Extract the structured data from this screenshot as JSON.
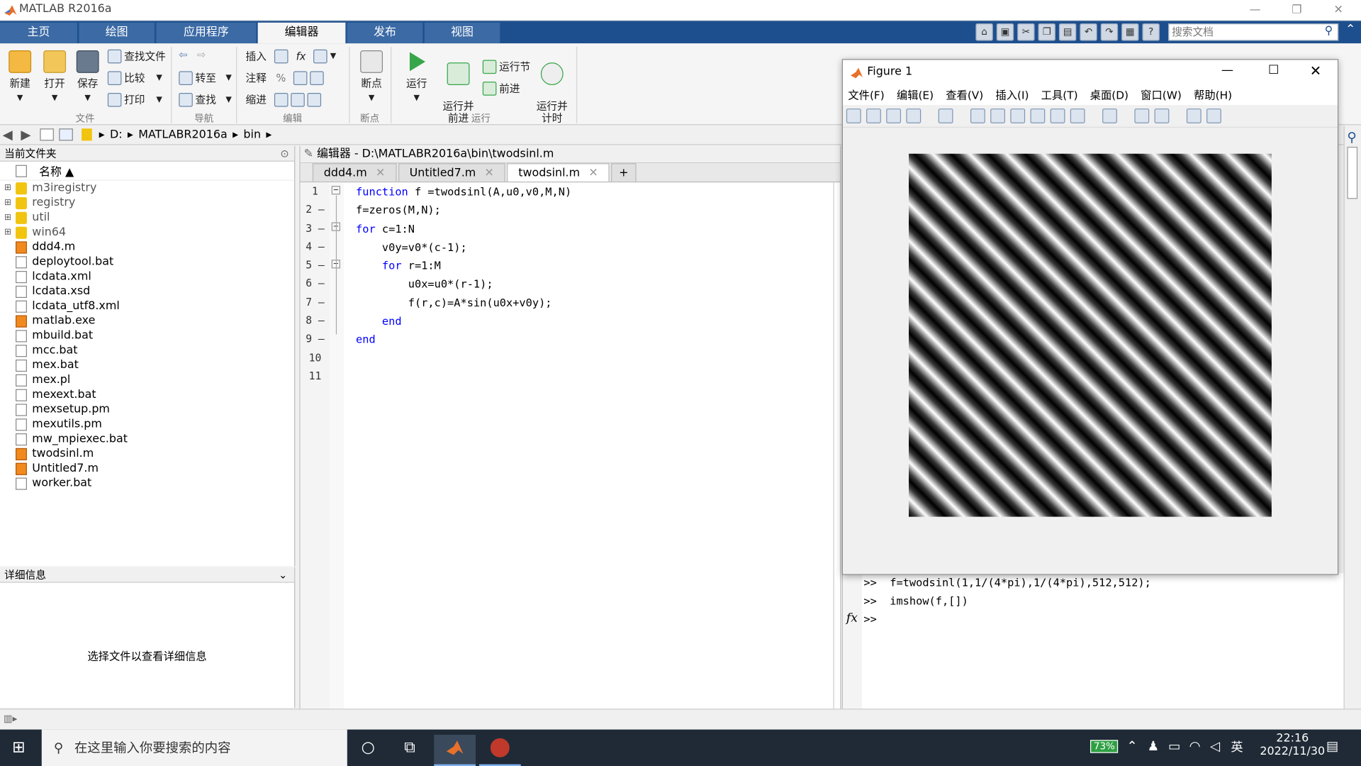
{
  "window": {
    "title": "MATLAB R2016a",
    "min": "—",
    "restore": "❐",
    "close": "✕"
  },
  "ribbon_tabs": [
    "主页",
    "绘图",
    "应用程序",
    "编辑器",
    "发布",
    "视图"
  ],
  "search_docs": {
    "placeholder": "搜索文档"
  },
  "ribbon": {
    "file": {
      "new": "新建",
      "open": "打开",
      "save": "保存",
      "find_files": "查找文件",
      "compare": "比较",
      "print": "打印",
      "group": "文件"
    },
    "nav": {
      "goto": "转至",
      "find": "查找",
      "group": "导航"
    },
    "edit": {
      "insert": "插入",
      "comment": "注释",
      "indent": "缩进",
      "fx": "fx",
      "percent": "%",
      "group": "编辑"
    },
    "breakpoints": {
      "label": "断点",
      "group": "断点"
    },
    "run": {
      "run": "运行",
      "run_advance": "运行并\n前进",
      "run_section": "运行节",
      "advance": "前进",
      "run_time": "运行并\n计时",
      "group": "运行"
    }
  },
  "address": {
    "parts": [
      "D:",
      "MATLABR2016a",
      "bin"
    ]
  },
  "file_browser": {
    "title": "当前文件夹",
    "column": "名称 ▲",
    "items": [
      {
        "name": "m3iregistry",
        "type": "folder"
      },
      {
        "name": "registry",
        "type": "folder"
      },
      {
        "name": "util",
        "type": "folder"
      },
      {
        "name": "win64",
        "type": "folder"
      },
      {
        "name": "ddd4.m",
        "type": "m"
      },
      {
        "name": "deploytool.bat",
        "type": "file"
      },
      {
        "name": "lcdata.xml",
        "type": "file"
      },
      {
        "name": "lcdata.xsd",
        "type": "file"
      },
      {
        "name": "lcdata_utf8.xml",
        "type": "file"
      },
      {
        "name": "matlab.exe",
        "type": "m"
      },
      {
        "name": "mbuild.bat",
        "type": "file"
      },
      {
        "name": "mcc.bat",
        "type": "file"
      },
      {
        "name": "mex.bat",
        "type": "file"
      },
      {
        "name": "mex.pl",
        "type": "file"
      },
      {
        "name": "mexext.bat",
        "type": "file"
      },
      {
        "name": "mexsetup.pm",
        "type": "file"
      },
      {
        "name": "mexutils.pm",
        "type": "file"
      },
      {
        "name": "mw_mpiexec.bat",
        "type": "file"
      },
      {
        "name": "twodsinl.m",
        "type": "m"
      },
      {
        "name": "Untitled7.m",
        "type": "m"
      },
      {
        "name": "worker.bat",
        "type": "file"
      }
    ]
  },
  "details": {
    "title": "详细信息",
    "message": "选择文件以查看详细信息"
  },
  "editor": {
    "title": "编辑器 - D:\\MATLABR2016a\\bin\\twodsinl.m",
    "tabs": [
      {
        "label": "ddd4.m"
      },
      {
        "label": "Untitled7.m"
      },
      {
        "label": "twodsinl.m"
      }
    ],
    "add_tab": "+",
    "line_numbers": [
      "1",
      "2 —",
      "3 —",
      "4 —",
      "5 —",
      "6 —",
      "7 —",
      "8 —",
      "9 —",
      "10",
      "11"
    ],
    "lines": [
      {
        "kw": "function",
        "rest": " f =twodsinl(A,u0,v0,M,N)"
      },
      {
        "kw": "",
        "rest": "f=zeros(M,N);"
      },
      {
        "kw": "for",
        "rest": " c=1:N"
      },
      {
        "kw": "",
        "rest": "    v0y=v0*(c-1);"
      },
      {
        "kw": "    for",
        "rest": " r=1:M"
      },
      {
        "kw": "",
        "rest": "        u0x=u0*(r-1);"
      },
      {
        "kw": "",
        "rest": "        f(r,c)=A*sin(u0x+v0y);"
      },
      {
        "kw": "    end",
        "rest": ""
      },
      {
        "kw": "end",
        "rest": ""
      },
      {
        "kw": "",
        "rest": ""
      },
      {
        "kw": "",
        "rest": ""
      }
    ]
  },
  "figure": {
    "title": "Figure 1",
    "menu": [
      "文件(F)",
      "编辑(E)",
      "查看(V)",
      "插入(I)",
      "工具(T)",
      "桌面(D)",
      "窗口(W)",
      "帮助(H)"
    ]
  },
  "command": {
    "lines": [
      ">>  f=twodsinl(1,1/(4*pi),1/(4*pi),512,512);",
      ">>  imshow(f,[])"
    ],
    "prompt": ">>",
    "fx": "fx"
  },
  "taskbar": {
    "search_placeholder": "在这里输入你要搜索的内容",
    "battery": "73%",
    "ime": "英",
    "time": "22:16",
    "date": "2022/11/30"
  }
}
